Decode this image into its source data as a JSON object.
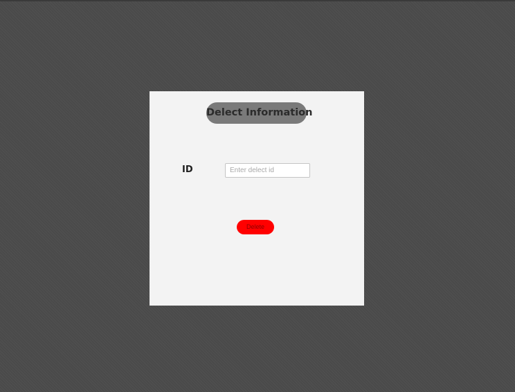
{
  "dialog": {
    "title": "Delect Information",
    "id_label": "ID",
    "id_input": {
      "value": "",
      "placeholder": "Enter delect id"
    },
    "delete_label": "Delete"
  },
  "colors": {
    "background": "#4a4a4a",
    "panel": "#f3f3f3",
    "title_pill": "#7a7a7a",
    "delete_button": "#ff0000"
  }
}
